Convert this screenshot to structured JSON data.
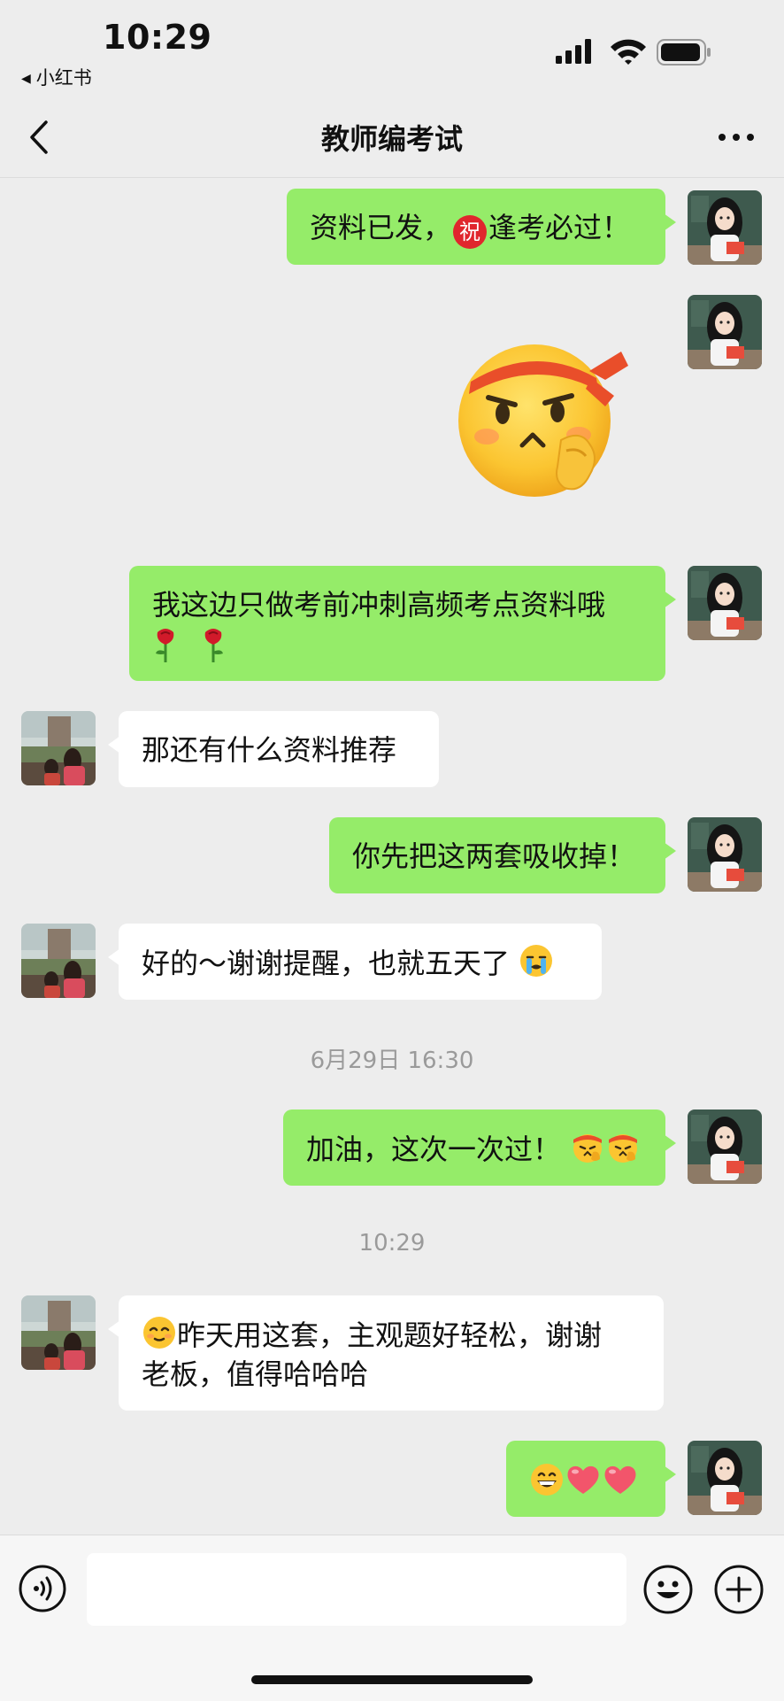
{
  "status": {
    "time": "10:29",
    "back_app": "小红书",
    "icons": [
      "signal-icon",
      "wifi-icon",
      "battery-icon"
    ]
  },
  "nav": {
    "title": "教师编考试",
    "back_icon": "chevron-left-icon",
    "more_icon": "more-dots-icon"
  },
  "messages": [
    {
      "from": "me",
      "text_before": "资料已发，",
      "emoji": "祝",
      "text_after": "逢考必过！"
    },
    {
      "from": "me",
      "sticker": "determined-face-sticker"
    },
    {
      "from": "me",
      "line1": "我这边只做考前冲刺高频考点资料哦",
      "line2_emoji": "rose-emoji x2"
    },
    {
      "from": "other",
      "text": "那还有什么资料推荐"
    },
    {
      "from": "me",
      "text": "你先把这两套吸收掉！"
    },
    {
      "from": "other",
      "text": "好的～谢谢提醒，也就五天了",
      "trailing_emoji": "crying-emoji"
    },
    {
      "from": "me",
      "text": "加油，这次一次过！",
      "trailing_emoji": "salute-emoji x2"
    },
    {
      "from": "other",
      "line1": "昨天用这套，主观题好轻松，谢谢",
      "line2": "老板，值得哈哈哈",
      "leading_emoji": "smirk-emoji"
    },
    {
      "from": "me",
      "emoji_only": "grin-emoji, heart-emoji, heart-emoji"
    }
  ],
  "timestamps": [
    "6月29日 16:30",
    "10:29"
  ],
  "input": {
    "value": "",
    "icons": [
      "voice-icon",
      "emoji-icon",
      "plus-icon"
    ]
  },
  "colors": {
    "background": "#ededed",
    "my_bubble": "#95ec69",
    "other_bubble": "#ffffff"
  }
}
